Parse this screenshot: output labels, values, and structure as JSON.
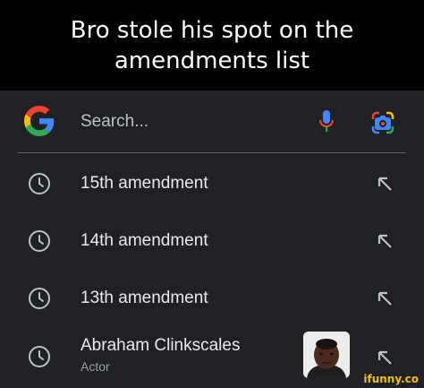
{
  "caption": {
    "line1": "Bro stole his spot on the",
    "line2": "amendments list"
  },
  "search": {
    "placeholder": "Search...",
    "logo_icon": "google-g-icon",
    "mic_icon": "microphone-icon",
    "lens_icon": "google-lens-icon"
  },
  "suggestions": [
    {
      "label": "15th amendment",
      "icon": "history-clock-icon",
      "action_icon": "arrow-up-left-icon"
    },
    {
      "label": "14th amendment",
      "icon": "history-clock-icon",
      "action_icon": "arrow-up-left-icon"
    },
    {
      "label": "13th amendment",
      "icon": "history-clock-icon",
      "action_icon": "arrow-up-left-icon"
    },
    {
      "label": "Abraham Clinkscales",
      "subtitle": "Actor",
      "icon": "history-clock-icon",
      "action_icon": "arrow-up-left-icon"
    }
  ],
  "watermark": "ifunny.co",
  "colors": {
    "background": "#202124",
    "text": "#e8eaed",
    "muted": "#9aa0a6",
    "google_blue": "#4285F4",
    "google_red": "#EA4335",
    "google_yellow": "#FBBC05",
    "google_green": "#34A853"
  }
}
